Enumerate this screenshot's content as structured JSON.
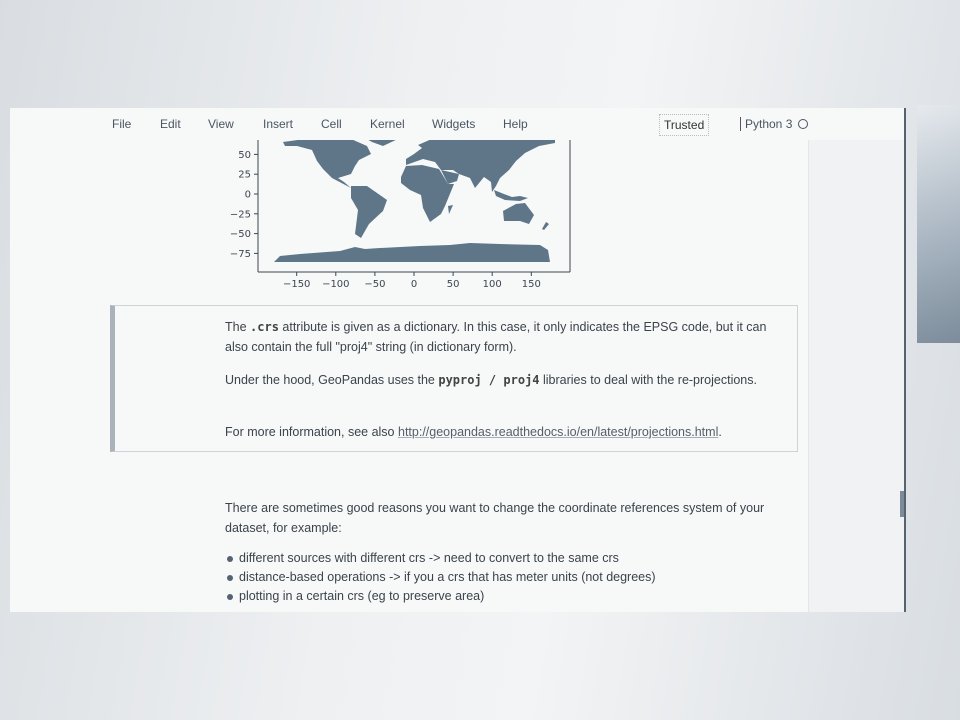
{
  "menu": {
    "items": [
      "File",
      "Edit",
      "View",
      "Insert",
      "Cell",
      "Kernel",
      "Widgets",
      "Help"
    ],
    "trusted": "Trusted",
    "kernel": "Python 3"
  },
  "plot": {
    "x_ticks": [
      "−150",
      "−100",
      "−50",
      "0",
      "50",
      "100",
      "150"
    ],
    "y_ticks": [
      "50",
      "25",
      "0",
      "−25",
      "−50",
      "−75"
    ],
    "land_color": "#5f7689"
  },
  "cell1": {
    "p1_a": "The ",
    "p1_code": ".crs",
    "p1_b": " attribute is given as a dictionary. In this case, it only indicates the EPSG code, but it can also contain the full \"proj4\" string (in dictionary form).",
    "p2_a": "Under the hood, GeoPandas uses the ",
    "p2_code1": "pyproj",
    "p2_sep": " / ",
    "p2_code2": "proj4",
    "p2_b": " libraries to deal with the re-projections.",
    "p3_a": "For more information, see also ",
    "p3_link": "http://geopandas.readthedocs.io/en/latest/projections.html",
    "p3_b": "."
  },
  "cell2": {
    "intro": "There are sometimes good reasons you want to change the coordinate references system of your dataset, for example:",
    "bullets": [
      "different sources with different crs -> need to convert to the same crs",
      "distance-based operations -> if you a crs that has meter units (not degrees)",
      "plotting in a certain crs (eg to preserve area)"
    ]
  }
}
